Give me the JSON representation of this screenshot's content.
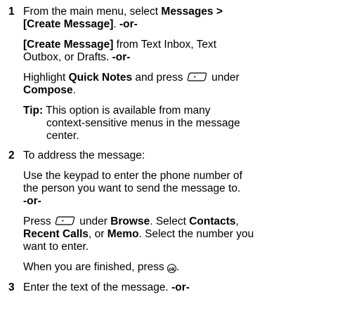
{
  "steps": [
    {
      "number": "1",
      "line1": {
        "pre": "From the main menu, select ",
        "b1": "Messages >"
      },
      "line2": {
        "b1": "[Create Message]",
        "mid": ". ",
        "or": "-or-"
      },
      "line3": {
        "b1": "[Create Message]",
        "rest": " from Text Inbox, Text"
      },
      "line4": {
        "pre": "Outbox, or Drafts. ",
        "or": "-or-"
      },
      "line5": {
        "pre": "Highlight ",
        "b1": "Quick Notes",
        "mid": " and press ",
        "post": " under"
      },
      "line6": {
        "b1": "Compose",
        "post": "."
      },
      "tip": {
        "label": "Tip:",
        "line1": " This option is available from many",
        "line2": "context-sensitive menus in the message",
        "line3": "center."
      }
    },
    {
      "number": "2",
      "line1": "To address the message:",
      "line2": "Use the keypad to enter the phone number of",
      "line3": "the person you want to send the message to.",
      "line4": "-or-",
      "line5": {
        "pre": "Press ",
        "mid": " under ",
        "b1": "Browse",
        "mid2": ". Select ",
        "b2": "Contacts",
        "post": ","
      },
      "line6": {
        "b1": "Recent Calls",
        "mid": ", or ",
        "b2": "Memo",
        "post": ". Select the number you"
      },
      "line7": "want to enter.",
      "line8": {
        "pre": "When you are finished, press ",
        "post": "."
      }
    },
    {
      "number": "3",
      "line1": {
        "pre": "Enter the text of the message. ",
        "or": "-or-"
      }
    }
  ],
  "icons": {
    "softkey": "left-softkey-icon",
    "ok": "ok-key-icon",
    "ok_text": "ok"
  }
}
